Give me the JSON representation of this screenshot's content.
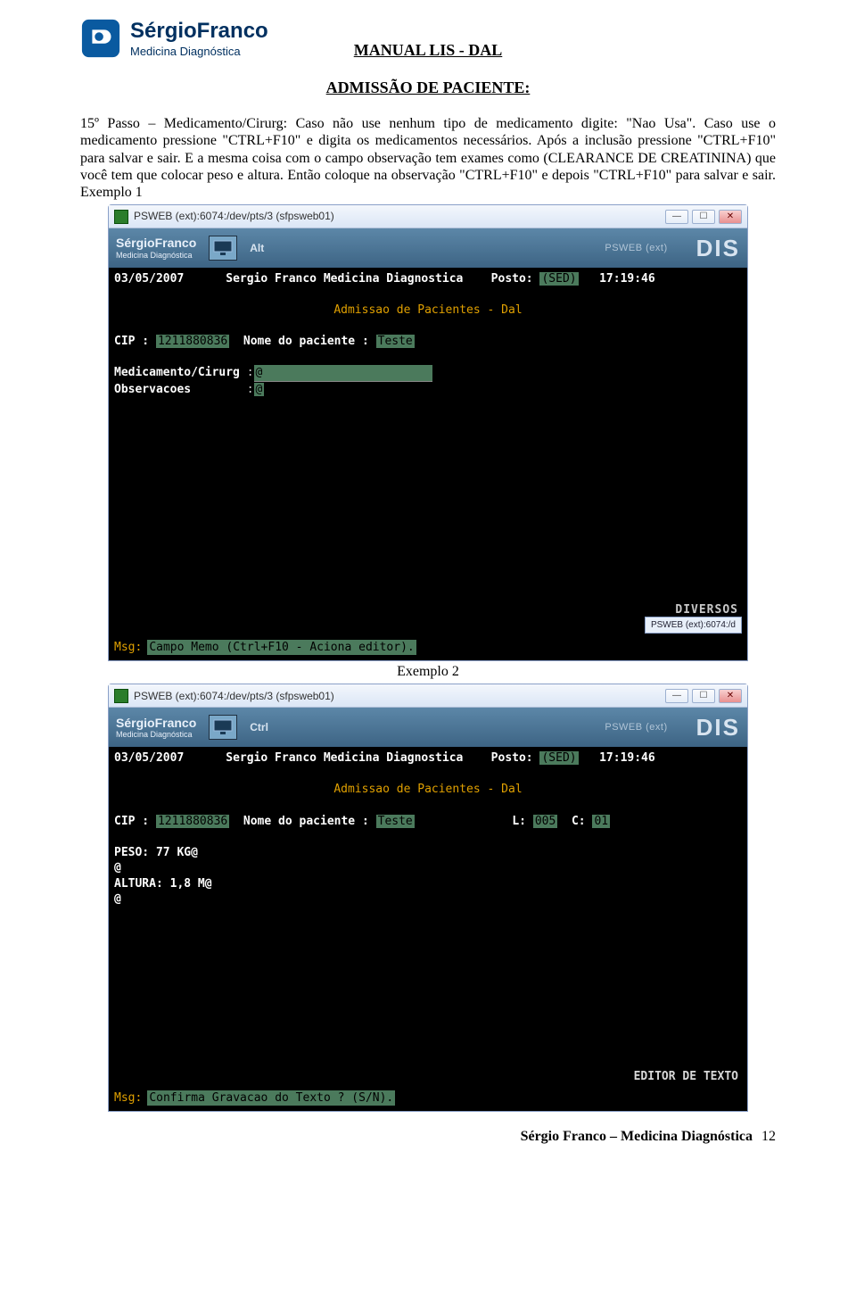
{
  "brand": {
    "name": "SérgioFranco",
    "subtitle": "Medicina Diagnóstica"
  },
  "titles": {
    "manual": "MANUAL LIS - DAL",
    "section": "ADMISSÃO DE PACIENTE:"
  },
  "paragraph": "15º Passo – Medicamento/Cirurg: Caso não use nenhum tipo de medicamento digite: \"Nao Usa\". Caso use o medicamento pressione \"CTRL+F10\" e digita os medicamentos necessários. Após a inclusão pressione \"CTRL+F10\" para salvar e sair. E a mesma coisa com o campo observação tem exames como (CLEARANCE DE CREATININA) que você tem que colocar peso e altura. Então coloque na observação \"CTRL+F10\" e depois \"CTRL+F10\" para salvar e sair.    Exemplo 1",
  "captions": {
    "ex2": "Exemplo 2"
  },
  "window_common": {
    "title": "PSWEB (ext):6074:/dev/pts/3 (sfpsweb01)",
    "alt_menu": "Alt",
    "ctrl_menu": "Ctrl",
    "dis": "DIS",
    "psweb_label": "PSWEB (ext)",
    "bottom_tag": "PSWEB (ext):6074:/d"
  },
  "term1": {
    "date": "03/05/2007",
    "company": "Sergio Franco Medicina Diagnostica",
    "posto_label": "Posto:",
    "posto_value": "(SED)",
    "time": "17:19:46",
    "screen_title": "Admissao de Pacientes - Dal",
    "cip_label": "CIP :",
    "cip_value": "1211880836",
    "nome_label": "Nome do paciente :",
    "nome_value": "Teste",
    "field1_label": "Medicamento/Cirurg",
    "field1_value": "@",
    "field2_label": "Observacoes",
    "field2_value": "@",
    "diversos": "DIVERSOS",
    "msg_label": "Msg:",
    "msg_text": "Campo Memo (Ctrl+F10 - Aciona editor)."
  },
  "term2": {
    "date": "03/05/2007",
    "company": "Sergio Franco Medicina Diagnostica",
    "posto_label": "Posto:",
    "posto_value": "(SED)",
    "time": "17:19:46",
    "screen_title": "Admissao de Pacientes - Dal",
    "cip_label": "CIP :",
    "cip_value": "1211880836",
    "nome_label": "Nome do paciente :",
    "nome_value": "Teste",
    "lc_l_label": "L:",
    "lc_l_value": "005",
    "lc_c_label": "C:",
    "lc_c_value": "01",
    "line1": "PESO: 77 KG@",
    "line2": "@",
    "line3": "ALTURA: 1,8 M@",
    "line4": "@",
    "editor_label": "EDITOR DE TEXTO",
    "msg_label": "Msg:",
    "msg_text": "Confirma Gravacao do Texto ? (S/N)."
  },
  "footer": {
    "text": "Sérgio Franco – Medicina Diagnóstica",
    "page": "12"
  }
}
